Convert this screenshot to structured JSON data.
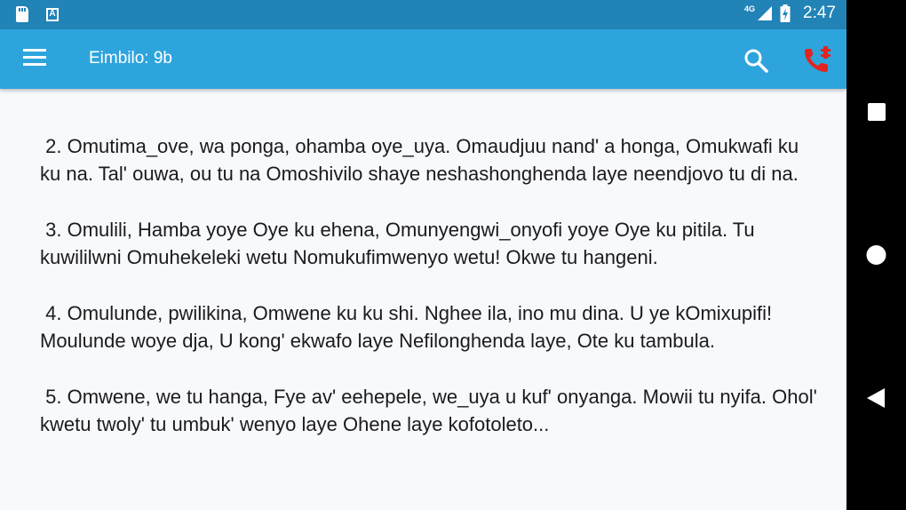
{
  "status_bar": {
    "left_icons": [
      "sd-card-icon",
      "a-notification-icon"
    ],
    "network": "4G",
    "time": "2:47"
  },
  "app_bar": {
    "title": "Eimbilo: 9b",
    "menu_icon": "hamburger-menu-icon",
    "search_icon": "search-icon",
    "call_icon": "phone-call-icon"
  },
  "colors": {
    "status_bar": "#2283b7",
    "app_bar": "#2ea4dd",
    "background": "#f7f9fd",
    "call_icon": "#e3231e"
  },
  "verses": [
    " 2. Omutima_ove, wa ponga, ohamba oye_uya. Omaudjuu nand' a honga, Omukwafi ku ku na. Tal' ouwa, ou tu na Omoshivilo shaye neshashonghenda laye neendjovo tu di na.",
    " 3. Omulili, Hamba yoye Oye ku ehena, Omunyengwi_onyofi yoye Oye ku pitila. Tu kuwililwni Omuhekeleki wetu Nomukufimwenyo wetu! Okwe tu hangeni.",
    " 4. Omulunde, pwilikina, Omwene ku ku shi. Nghee ila, ino mu dina. U ye kOmixupifi! Moulunde woye dja, U kong' ekwafo laye Nefilonghenda laye, Ote ku tambula.",
    " 5. Omwene, we tu hanga, Fye av' eehepele, we_uya u kuf' onyanga. Mowii tu nyifa. Ohol' kwetu twoly' tu umbuk' wenyo laye Ohene laye kofotoleto..."
  ],
  "nav_bar": {
    "buttons": [
      "recents-square-icon",
      "home-circle-icon",
      "back-triangle-icon"
    ]
  }
}
